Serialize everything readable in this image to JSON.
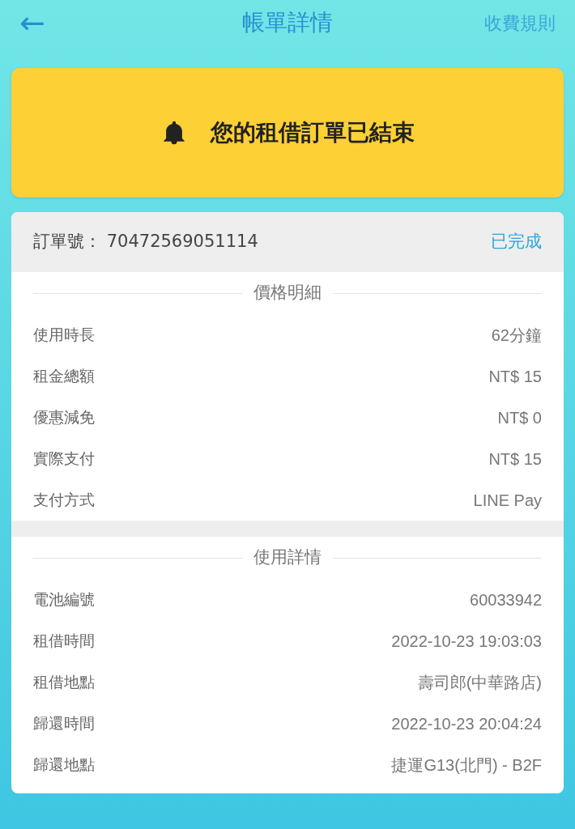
{
  "header": {
    "back": "←",
    "title": "帳單詳情",
    "link": "收費規則"
  },
  "banner": {
    "text": "您的租借訂單已結束"
  },
  "order": {
    "label": "訂單號：",
    "number": "70472569051114",
    "status": "已完成"
  },
  "sections": [
    {
      "title": "價格明細",
      "rows": [
        {
          "label": "使用時長",
          "value": "62分鐘"
        },
        {
          "label": "租金總額",
          "value": "NT$ 15"
        },
        {
          "label": "優惠減免",
          "value": "NT$ 0"
        },
        {
          "label": "實際支付",
          "value": "NT$ 15"
        },
        {
          "label": "支付方式",
          "value": "LINE Pay"
        }
      ]
    },
    {
      "title": "使用詳情",
      "rows": [
        {
          "label": "電池編號",
          "value": "60033942"
        },
        {
          "label": "租借時間",
          "value": "2022-10-23 19:03:03"
        },
        {
          "label": "租借地點",
          "value": "壽司郎(中華路店)"
        },
        {
          "label": "歸還時間",
          "value": "2022-10-23 20:04:24"
        },
        {
          "label": "歸還地點",
          "value": "捷運G13(北門) - B2F"
        }
      ]
    }
  ]
}
